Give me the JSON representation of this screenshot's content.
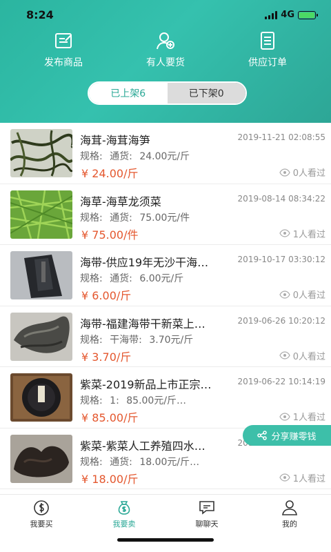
{
  "status_bar": {
    "time": "8:24",
    "network": "4G"
  },
  "header": {
    "actions": [
      {
        "label": "发布商品",
        "icon": "edit-icon"
      },
      {
        "label": "有人要货",
        "icon": "user-add-icon"
      },
      {
        "label": "供应订单",
        "icon": "document-icon"
      }
    ],
    "tabs": [
      {
        "label": "已上架6",
        "active": true
      },
      {
        "label": "已下架0",
        "active": false
      }
    ]
  },
  "products": [
    {
      "title": "海茸-海茸海笋",
      "date": "2019-11-21 02:08:55",
      "spec_label": "规格:",
      "spec_type": "通货:",
      "spec_price": "24.00元/斤",
      "price": "¥ 24.00/斤",
      "views": "0人看过"
    },
    {
      "title": "海草-海草龙须菜",
      "date": "2019-08-14 08:34:22",
      "spec_label": "规格:",
      "spec_type": "通货:",
      "spec_price": "75.00元/件",
      "price": "¥ 75.00/件",
      "views": "1人看过"
    },
    {
      "title": "海带-供应19年无沙干海…",
      "date": "2019-10-17 03:30:12",
      "spec_label": "规格:",
      "spec_type": "通货:",
      "spec_price": "6.00元/斤",
      "price": "¥ 6.00/斤",
      "views": "0人看过"
    },
    {
      "title": "海带-福建海带干新菜上…",
      "date": "2019-06-26 10:20:12",
      "spec_label": "规格:",
      "spec_type": "干海带:",
      "spec_price": "3.70元/斤",
      "price": "¥ 3.70/斤",
      "views": "0人看过"
    },
    {
      "title": "紫菜-2019新品上市正宗…",
      "date": "2019-06-22 10:14:19",
      "spec_label": "规格:",
      "spec_type": "1:",
      "spec_price": "85.00元/斤…",
      "price": "¥ 85.00/斤",
      "views": "1人看过"
    },
    {
      "title": "紫菜-紫菜人工养殖四水…",
      "date": "2019-07-25 02:07:50",
      "spec_label": "规格:",
      "spec_type": "通货:",
      "spec_price": "18.00元/斤…",
      "price": "¥ 18.00/斤",
      "views": "1人看过"
    }
  ],
  "share_button": {
    "label": "分享赚零钱"
  },
  "bottom_nav": [
    {
      "label": "我要买",
      "icon": "wallet-icon",
      "active": false
    },
    {
      "label": "我要卖",
      "icon": "money-bag-icon",
      "active": true
    },
    {
      "label": "聊聊天",
      "icon": "chat-icon",
      "active": false
    },
    {
      "label": "我的",
      "icon": "profile-icon",
      "active": false
    }
  ],
  "colors": {
    "accent": "#2bb5a0",
    "price": "#e4572e",
    "share": "#3dbfa9"
  }
}
